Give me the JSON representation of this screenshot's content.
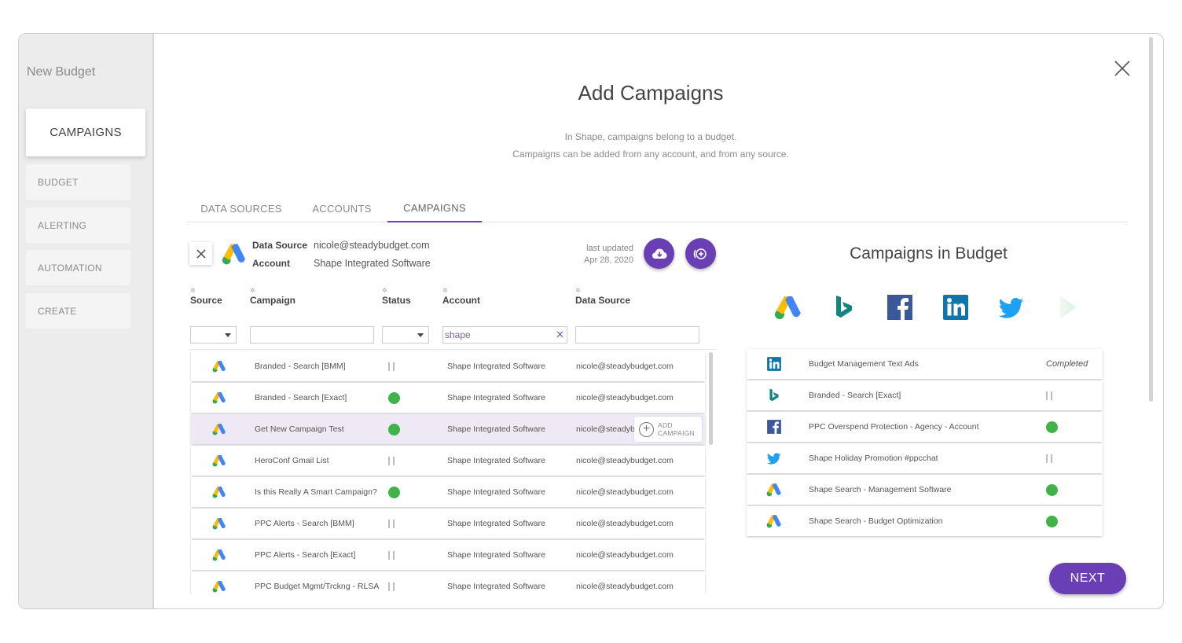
{
  "sidebar": {
    "title": "New Budget",
    "active": "CAMPAIGNS",
    "items": [
      "BUDGET",
      "ALERTING",
      "AUTOMATION",
      "CREATE"
    ]
  },
  "modal": {
    "title": "Add Campaigns",
    "subtitle_line1": "In Shape, campaigns belong to a budget.",
    "subtitle_line2": "Campaigns can be added from any account, and from any source."
  },
  "tabs": [
    "DATA SOURCES",
    "ACCOUNTS",
    "CAMPAIGNS"
  ],
  "active_tab": "CAMPAIGNS",
  "data_source": {
    "source_label": "Data Source",
    "source_value": "nicole@steadybudget.com",
    "account_label": "Account",
    "account_value": "Shape Integrated Software",
    "updated_label": "last updated",
    "updated_date": "Apr 28, 2020",
    "icon": "google-ads-icon"
  },
  "table": {
    "headers": [
      "Source",
      "Campaign",
      "Status",
      "Account",
      "Data Source"
    ],
    "filters": {
      "account": "shape"
    },
    "add_button_line1": "ADD",
    "add_button_line2": "CAMPAIGN",
    "rows": [
      {
        "campaign": "Branded - Search [BMM]",
        "status": "paused",
        "account": "Shape Integrated Software",
        "source": "nicole@steadybudget.com"
      },
      {
        "campaign": "Branded - Search [Exact]",
        "status": "active",
        "account": "Shape Integrated Software",
        "source": "nicole@steadybudget.com"
      },
      {
        "campaign": "Get New Campaign Test",
        "status": "active",
        "account": "Shape Integrated Software",
        "source": "nicole@steadyb",
        "highlighted": true
      },
      {
        "campaign": "HeroConf Gmail List",
        "status": "paused",
        "account": "Shape Integrated Software",
        "source": "nicole@steadybudget.com"
      },
      {
        "campaign": "Is this Really A Smart Campaign?",
        "status": "active",
        "account": "Shape Integrated Software",
        "source": "nicole@steadybudget.com"
      },
      {
        "campaign": "PPC Alerts - Search [BMM]",
        "status": "paused",
        "account": "Shape Integrated Software",
        "source": "nicole@steadybudget.com"
      },
      {
        "campaign": "PPC Alerts - Search [Exact]",
        "status": "paused",
        "account": "Shape Integrated Software",
        "source": "nicole@steadybudget.com"
      },
      {
        "campaign": "PPC Budget Mgmt/Trckng - RLSA",
        "status": "paused",
        "account": "Shape Integrated Software",
        "source": "nicole@steadybudget.com"
      }
    ]
  },
  "budget_panel": {
    "title": "Campaigns in Budget",
    "source_icons": [
      "google-ads-icon",
      "bing-icon",
      "facebook-icon",
      "linkedin-icon",
      "twitter-icon",
      "play-icon"
    ],
    "campaigns": [
      {
        "icon": "linkedin-icon",
        "name": "Budget Management Text Ads",
        "status": "Completed"
      },
      {
        "icon": "bing-icon",
        "name": "Branded - Search [Exact]",
        "status": "paused"
      },
      {
        "icon": "facebook-icon",
        "name": "PPC Overspend Protection - Agency - Account",
        "status": "active"
      },
      {
        "icon": "twitter-icon",
        "name": "Shape Holiday Promotion #ppcchat",
        "status": "paused"
      },
      {
        "icon": "google-ads-icon",
        "name": "Shape Search - Management Software",
        "status": "active"
      },
      {
        "icon": "google-ads-icon",
        "name": "Shape Search - Budget Optimization",
        "status": "active"
      }
    ]
  },
  "next_label": "NEXT",
  "colors": {
    "accent": "#6a3fb6",
    "active_status": "#3fb249",
    "row_highlight": "#efe9f5"
  }
}
